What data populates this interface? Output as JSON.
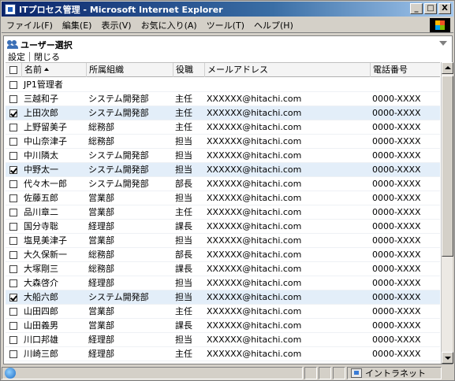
{
  "window": {
    "title": "ITプロセス管理 - Microsoft Internet Explorer",
    "buttons": {
      "minimize": "_",
      "maximize": "□",
      "close": "X"
    }
  },
  "menu": [
    "ファイル(F)",
    "編集(E)",
    "表示(V)",
    "お気に入り(A)",
    "ツール(T)",
    "ヘルプ(H)"
  ],
  "panel": {
    "title": "ユーザー選択",
    "toolbar": {
      "set": "設定",
      "close": "閉じる"
    }
  },
  "table": {
    "columns": [
      "名前",
      "所属組織",
      "役職",
      "メールアドレス",
      "電話番号"
    ],
    "rows": [
      {
        "checked": false,
        "name": "JP1管理者",
        "org": "",
        "role": "",
        "mail": "",
        "tel": ""
      },
      {
        "checked": false,
        "name": "三越和子",
        "org": "システム開発部",
        "role": "主任",
        "mail": "XXXXXX@hitachi.com",
        "tel": "0000-XXXX"
      },
      {
        "checked": true,
        "name": "上田次郎",
        "org": "システム開発部",
        "role": "主任",
        "mail": "XXXXXX@hitachi.com",
        "tel": "0000-XXXX"
      },
      {
        "checked": false,
        "name": "上野留美子",
        "org": "総務部",
        "role": "主任",
        "mail": "XXXXXX@hitachi.com",
        "tel": "0000-XXXX"
      },
      {
        "checked": false,
        "name": "中山奈津子",
        "org": "総務部",
        "role": "担当",
        "mail": "XXXXXX@hitachi.com",
        "tel": "0000-XXXX"
      },
      {
        "checked": false,
        "name": "中川隣太",
        "org": "システム開発部",
        "role": "担当",
        "mail": "XXXXXX@hitachi.com",
        "tel": "0000-XXXX"
      },
      {
        "checked": true,
        "name": "中野太一",
        "org": "システム開発部",
        "role": "担当",
        "mail": "XXXXXX@hitachi.com",
        "tel": "0000-XXXX"
      },
      {
        "checked": false,
        "name": "代々木一郎",
        "org": "システム開発部",
        "role": "部長",
        "mail": "XXXXXX@hitachi.com",
        "tel": "0000-XXXX"
      },
      {
        "checked": false,
        "name": "佐藤五郎",
        "org": "営業部",
        "role": "担当",
        "mail": "XXXXXX@hitachi.com",
        "tel": "0000-XXXX"
      },
      {
        "checked": false,
        "name": "品川章二",
        "org": "営業部",
        "role": "主任",
        "mail": "XXXXXX@hitachi.com",
        "tel": "0000-XXXX"
      },
      {
        "checked": false,
        "name": "国分寺聡",
        "org": "経理部",
        "role": "課長",
        "mail": "XXXXXX@hitachi.com",
        "tel": "0000-XXXX"
      },
      {
        "checked": false,
        "name": "塩見美津子",
        "org": "営業部",
        "role": "担当",
        "mail": "XXXXXX@hitachi.com",
        "tel": "0000-XXXX"
      },
      {
        "checked": false,
        "name": "大久保新一",
        "org": "総務部",
        "role": "部長",
        "mail": "XXXXXX@hitachi.com",
        "tel": "0000-XXXX"
      },
      {
        "checked": false,
        "name": "大塚剛三",
        "org": "総務部",
        "role": "課長",
        "mail": "XXXXXX@hitachi.com",
        "tel": "0000-XXXX"
      },
      {
        "checked": false,
        "name": "大森啓介",
        "org": "経理部",
        "role": "担当",
        "mail": "XXXXXX@hitachi.com",
        "tel": "0000-XXXX"
      },
      {
        "checked": true,
        "name": "大船六郎",
        "org": "システム開発部",
        "role": "担当",
        "mail": "XXXXXX@hitachi.com",
        "tel": "0000-XXXX"
      },
      {
        "checked": false,
        "name": "山田四郎",
        "org": "営業部",
        "role": "主任",
        "mail": "XXXXXX@hitachi.com",
        "tel": "0000-XXXX"
      },
      {
        "checked": false,
        "name": "山田義男",
        "org": "営業部",
        "role": "課長",
        "mail": "XXXXXX@hitachi.com",
        "tel": "0000-XXXX"
      },
      {
        "checked": false,
        "name": "川口邦雄",
        "org": "経理部",
        "role": "担当",
        "mail": "XXXXXX@hitachi.com",
        "tel": "0000-XXXX"
      },
      {
        "checked": false,
        "name": "川崎三郎",
        "org": "経理部",
        "role": "主任",
        "mail": "XXXXXX@hitachi.com",
        "tel": "0000-XXXX"
      },
      {
        "checked": false,
        "name": "",
        "org": "",
        "role": "",
        "mail": "",
        "tel": ""
      }
    ]
  },
  "status": {
    "zone": "イントラネット"
  },
  "colors": {
    "title_bar": "#0a246a",
    "selected_row": "#e3eef9",
    "chrome": "#d4d0c8"
  }
}
